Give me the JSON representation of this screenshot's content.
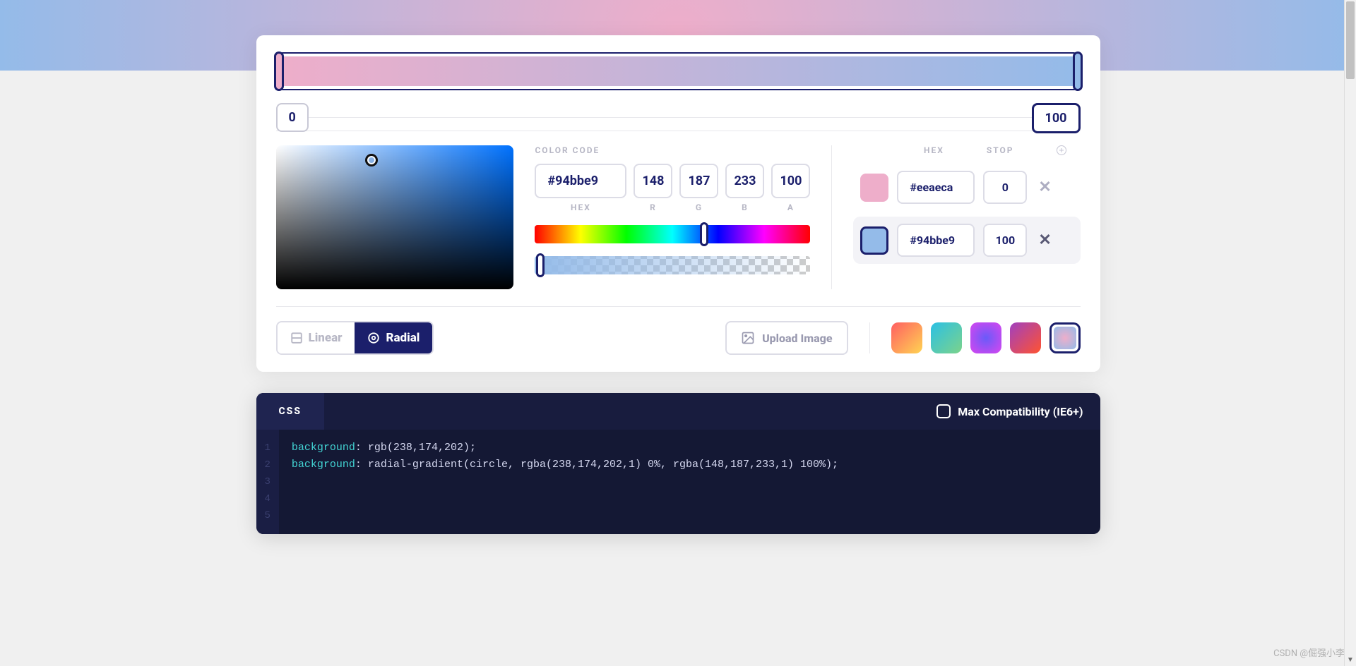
{
  "gradient": {
    "stop_left": "0",
    "stop_right": "100"
  },
  "color_code": {
    "label": "COLOR CODE",
    "hex": "#94bbe9",
    "r": "148",
    "g": "187",
    "b": "233",
    "a": "100",
    "sub_hex": "HEX",
    "sub_r": "R",
    "sub_g": "G",
    "sub_b": "B",
    "sub_a": "A"
  },
  "stops_header": {
    "hex": "HEX",
    "stop": "STOP"
  },
  "stops": [
    {
      "color": "#eeaeca",
      "hex": "#eeaeca",
      "stop": "0",
      "active": false
    },
    {
      "color": "#94bbe9",
      "hex": "#94bbe9",
      "stop": "100",
      "active": true
    }
  ],
  "toggle": {
    "linear": "Linear",
    "radial": "Radial"
  },
  "upload": "Upload Image",
  "presets": [
    {
      "bg": "linear-gradient(135deg,#ff5e62,#ffd452)"
    },
    {
      "bg": "linear-gradient(135deg,#2bc0e4,#7cd38a)"
    },
    {
      "bg": "radial-gradient(circle,#6a5af9,#d946ef)"
    },
    {
      "bg": "linear-gradient(135deg,#a040c0,#ff5330)"
    },
    {
      "bg": "radial-gradient(circle,#eeaeca,#94bbe9)",
      "selected": true
    }
  ],
  "code": {
    "tab": "CSS",
    "compat": "Max Compatibility (IE6+)",
    "lines": [
      "1",
      "2",
      "3",
      "4",
      "5"
    ],
    "l1a": "background",
    "l1b": ": rgb(238,174,202);",
    "l2a": "background",
    "l2b": ": radial-gradient(circle, rgba(238,174,202,1) 0%, rgba(148,187,233,1) 100%);"
  },
  "watermark": "CSDN @倔强小李"
}
